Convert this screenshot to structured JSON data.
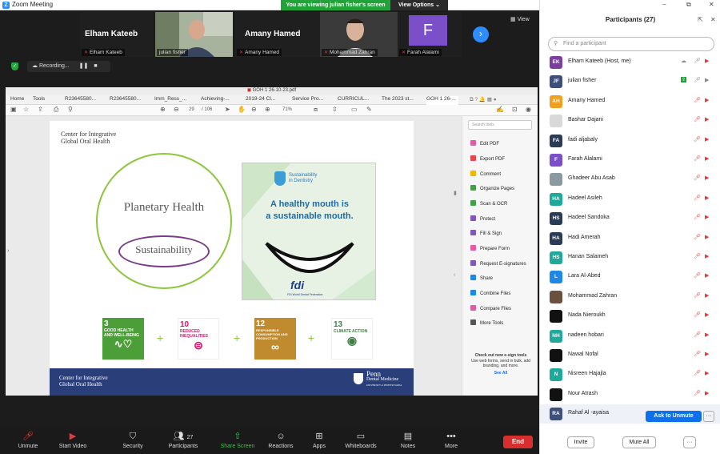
{
  "titlebar": {
    "title": "Zoom Meeting",
    "viewing": "You are viewing julian fisher's screen",
    "view_options": "View Options"
  },
  "gallery": {
    "tiles": [
      {
        "name": "Elham Kateeb",
        "label": "Elham Kateeb"
      },
      {
        "name": "",
        "label": "julian fisher"
      },
      {
        "name": "Amany Hamed",
        "label": "Amany Hamed"
      },
      {
        "name": "",
        "label": "Mohammad Zahran"
      },
      {
        "name": "F",
        "label": "Farah Alalami"
      }
    ],
    "view_label": "View",
    "recording": "Recording..."
  },
  "pdf": {
    "title": "GOH 1 26-10-23.pdf",
    "tabs": [
      "Home",
      "Tools",
      "R23645580...",
      "R23645580...",
      "Imm_Ress_...",
      "Achieving-...",
      "2019-24 Cl...",
      "Service Pro...",
      "CURRICUL...",
      "The 2023 st...",
      "GOH 1 26-..."
    ],
    "page_current": "29",
    "page_total": "/ 106",
    "zoom": "71%",
    "search_tools": "Search tools",
    "tools": [
      "Edit PDF",
      "Export PDF",
      "Comment",
      "Organize Pages",
      "Scan & OCR",
      "Protect",
      "Fill & Sign",
      "Prepare Form",
      "Request E-signatures",
      "Share",
      "Combine Files",
      "Compare Files",
      "More Tools"
    ],
    "promo_title": "Check out new e-sign tools",
    "promo_text": "Use web forms, send in bulk, add branding, and more.",
    "promo_link": "See All"
  },
  "slide": {
    "org_line1": "Center for Integrative",
    "org_line2": "Global Oral Health",
    "planetary": "Planetary Health",
    "sustainability": "Sustainability",
    "poster_badge1": "Sustainability",
    "poster_badge2": "in Dentistry",
    "poster_line1": "A healthy mouth is",
    "poster_line2": "a sustainable mouth.",
    "poster_logo": "fdi",
    "poster_logo_sub": "FDI World Dental Federation",
    "sdgs": [
      {
        "num": "3",
        "text": "GOOD HEALTH AND WELL-BEING",
        "color": "#4c9f38"
      },
      {
        "num": "10",
        "text": "REDUCED INEQUALITIES",
        "color": "#dd1367"
      },
      {
        "num": "12",
        "text": "RESPONSIBLE CONSUMPTION AND PRODUCTION",
        "color": "#bf8b2e"
      },
      {
        "num": "13",
        "text": "CLIMATE ACTION",
        "color": "#3f7e44"
      }
    ],
    "footer_org1": "Center for Integrative",
    "footer_org2": "Global Oral Health",
    "penn1": "Penn",
    "penn2": "Dental Medicine",
    "penn3": "UNIVERSITY of PENNSYLVANIA"
  },
  "toolbar": {
    "unmute": "Unmute",
    "start_video": "Start Video",
    "security": "Security",
    "participants": "Participants",
    "participants_count": "27",
    "share_screen": "Share Screen",
    "reactions": "Reactions",
    "apps": "Apps",
    "whiteboards": "Whiteboards",
    "notes": "Notes",
    "more": "More",
    "end": "End"
  },
  "panel": {
    "title": "Participants (27)",
    "search_placeholder": "Find a participant",
    "participants": [
      {
        "initials": "EK",
        "name": "Elham Kateeb (Host, me)",
        "color": "#7a3fa0"
      },
      {
        "initials": "JF",
        "name": "julian fisher",
        "color": "#3d4f7a"
      },
      {
        "initials": "AH",
        "name": "Amany Hamed",
        "color": "#f0a020"
      },
      {
        "initials": "",
        "name": "Bashar Dajani",
        "color": "#d9d9d9"
      },
      {
        "initials": "FA",
        "name": "fadi aljabaly",
        "color": "#2b3a55"
      },
      {
        "initials": "F",
        "name": "Farah Alalami",
        "color": "#7b4fc9"
      },
      {
        "initials": "",
        "name": "Ghadeer Abu Asab",
        "color": "#8a9aa0"
      },
      {
        "initials": "HA",
        "name": "Hadeel Asileh",
        "color": "#20a89a"
      },
      {
        "initials": "HS",
        "name": "Hadeel Sandoka",
        "color": "#2b3a55"
      },
      {
        "initials": "HA",
        "name": "Hadi Amerah",
        "color": "#2b3a55"
      },
      {
        "initials": "HS",
        "name": "Hanan Salameh",
        "color": "#20a89a"
      },
      {
        "initials": "L",
        "name": "Lara Al-Abed",
        "color": "#1e88e5"
      },
      {
        "initials": "",
        "name": "Mohammad Zahran",
        "color": "#6b5040"
      },
      {
        "initials": "",
        "name": "Nada Nieroukh",
        "color": "#111111"
      },
      {
        "initials": "NH",
        "name": "nadeen hobari",
        "color": "#20a89a"
      },
      {
        "initials": "",
        "name": "Nawal Nofal",
        "color": "#111111"
      },
      {
        "initials": "N",
        "name": "Nisreen Hajajla",
        "color": "#20a89a"
      },
      {
        "initials": "",
        "name": "Nour Atrash",
        "color": "#111111"
      },
      {
        "initials": "RA",
        "name": "Rahaf Al -ayaisa",
        "color": "#3d4f7a"
      }
    ],
    "ask_unmute": "Ask to Unmute",
    "invite": "Invite",
    "mute_all": "Mute All",
    "more": "···"
  }
}
